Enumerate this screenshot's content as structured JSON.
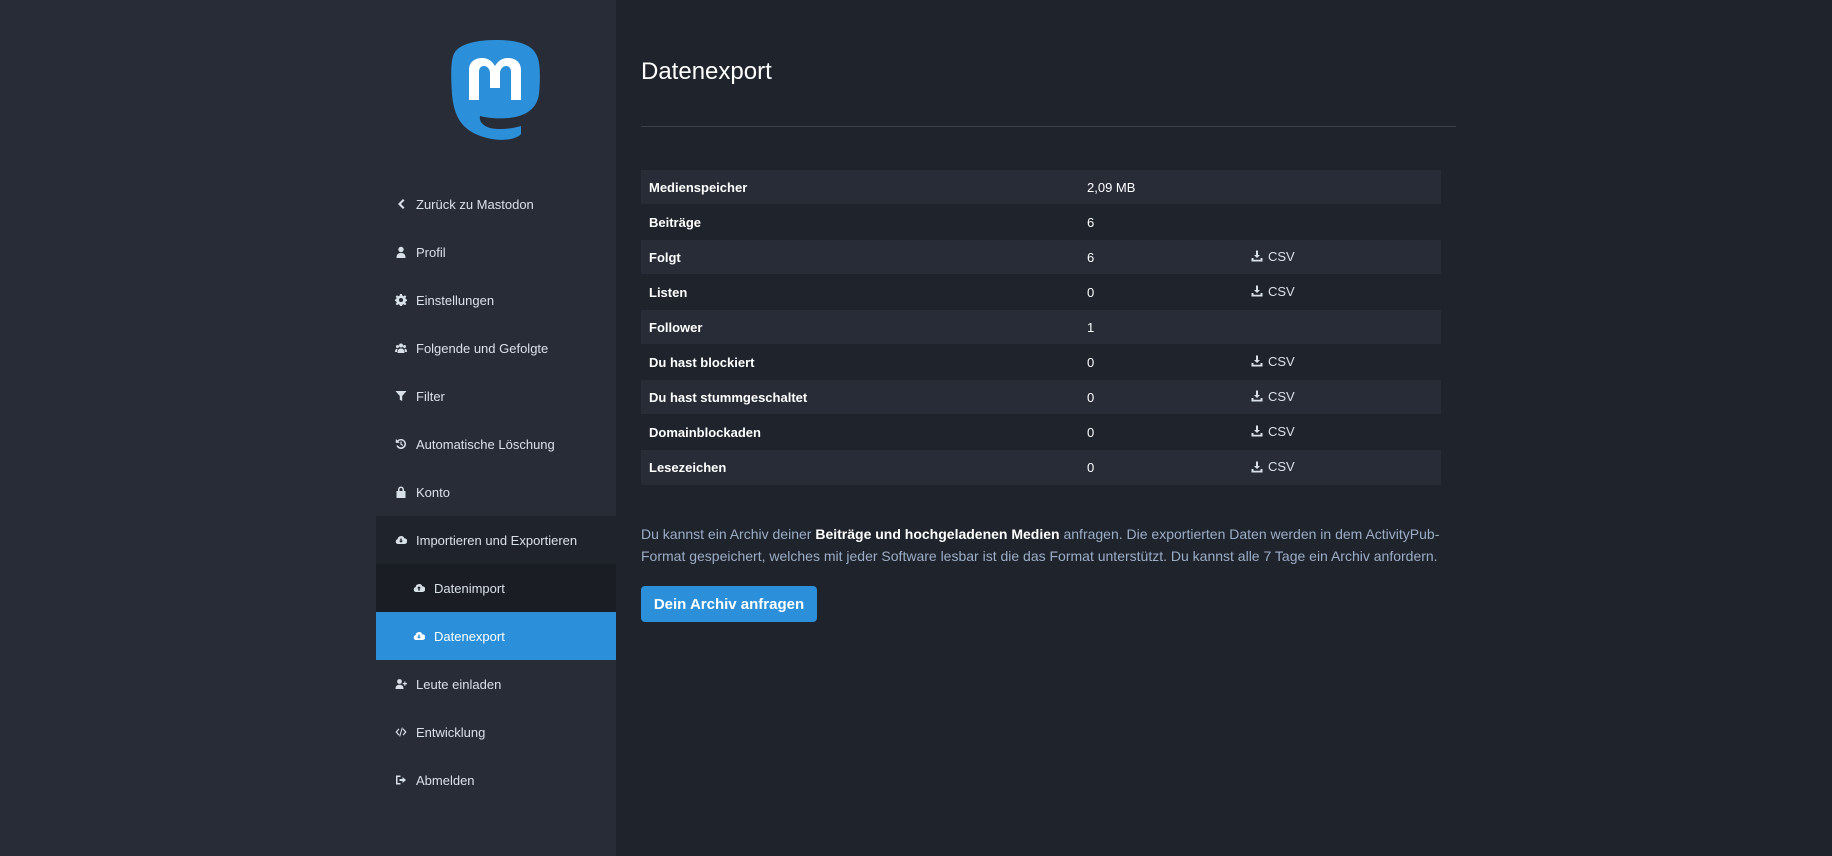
{
  "colors": {
    "sidebar_bg": "#282c37",
    "main_bg": "#1f232b",
    "accent": "#2b90d9",
    "text": "#d9e1e8",
    "muted_text": "#9baec8"
  },
  "sidebar": {
    "logo": "mastodon-logo",
    "items": [
      {
        "label": "Zurück zu Mastodon",
        "icon": "chevron-left-icon"
      },
      {
        "label": "Profil",
        "icon": "user-icon"
      },
      {
        "label": "Einstellungen",
        "icon": "gear-icon"
      },
      {
        "label": "Folgende und Gefolgte",
        "icon": "users-icon"
      },
      {
        "label": "Filter",
        "icon": "filter-icon"
      },
      {
        "label": "Automatische Löschung",
        "icon": "history-icon"
      },
      {
        "label": "Konto",
        "icon": "lock-icon"
      },
      {
        "label": "Importieren und Exportieren",
        "icon": "cloud-download-icon"
      },
      {
        "label": "Datenimport",
        "icon": "cloud-upload-icon"
      },
      {
        "label": "Datenexport",
        "icon": "cloud-download-icon"
      },
      {
        "label": "Leute einladen",
        "icon": "user-plus-icon"
      },
      {
        "label": "Entwicklung",
        "icon": "code-icon"
      },
      {
        "label": "Abmelden",
        "icon": "sign-out-icon"
      }
    ]
  },
  "main": {
    "title": "Datenexport",
    "rows": [
      {
        "label": "Medienspeicher",
        "value": "2,09 MB",
        "action": ""
      },
      {
        "label": "Beiträge",
        "value": "6",
        "action": ""
      },
      {
        "label": "Folgt",
        "value": "6",
        "action": "CSV"
      },
      {
        "label": "Listen",
        "value": "0",
        "action": "CSV"
      },
      {
        "label": "Follower",
        "value": "1",
        "action": ""
      },
      {
        "label": "Du hast blockiert",
        "value": "0",
        "action": "CSV"
      },
      {
        "label": "Du hast stummgeschaltet",
        "value": "0",
        "action": "CSV"
      },
      {
        "label": "Domainblockaden",
        "value": "0",
        "action": "CSV"
      },
      {
        "label": "Lesezeichen",
        "value": "0",
        "action": "CSV"
      }
    ],
    "description": {
      "before": "Du kannst ein Archiv deiner ",
      "bold": "Beiträge und hochgeladenen Medien",
      "after": " anfragen. Die exportierten Daten werden in dem ActivityPub-Format gespeichert, welches mit jeder Software lesbar ist die das Format unterstützt. Du kannst alle 7 Tage ein Archiv anfordern."
    },
    "button_label": "Dein Archiv anfragen"
  }
}
